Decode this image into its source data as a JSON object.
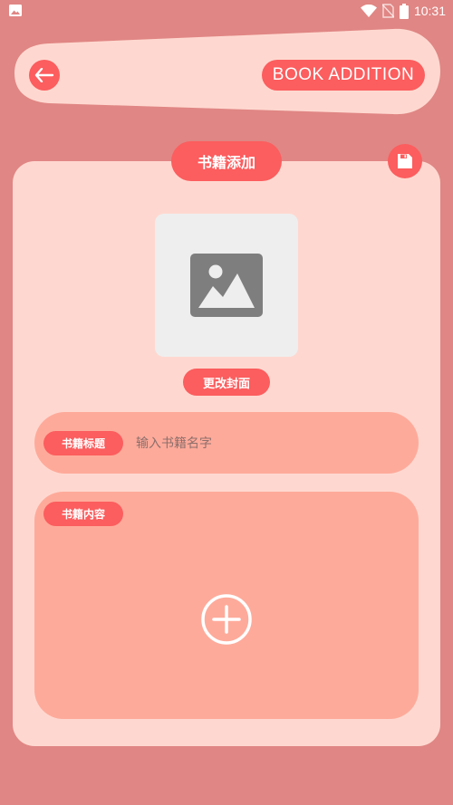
{
  "status_bar": {
    "time": "10:31",
    "icons": [
      "image-notification-icon",
      "wifi-icon",
      "no-sim-icon",
      "battery-icon"
    ]
  },
  "header": {
    "title": "BOOK ADDITION",
    "back_icon": "arrow-left-icon"
  },
  "card": {
    "title": "书籍添加",
    "save_icon": "save-icon",
    "cover": {
      "placeholder_icon": "image-placeholder-icon",
      "change_button": "更改封面"
    },
    "title_field": {
      "label": "书籍标题",
      "value": "",
      "placeholder": "输入书籍名字"
    },
    "content_field": {
      "label": "书籍内容",
      "add_icon": "add-circle-icon"
    }
  },
  "colors": {
    "background": "#E08684",
    "accent": "#FC5D5E",
    "card": "#FED8D0",
    "field": "#FEAA9A",
    "cover_bg": "#EEEEEE"
  }
}
